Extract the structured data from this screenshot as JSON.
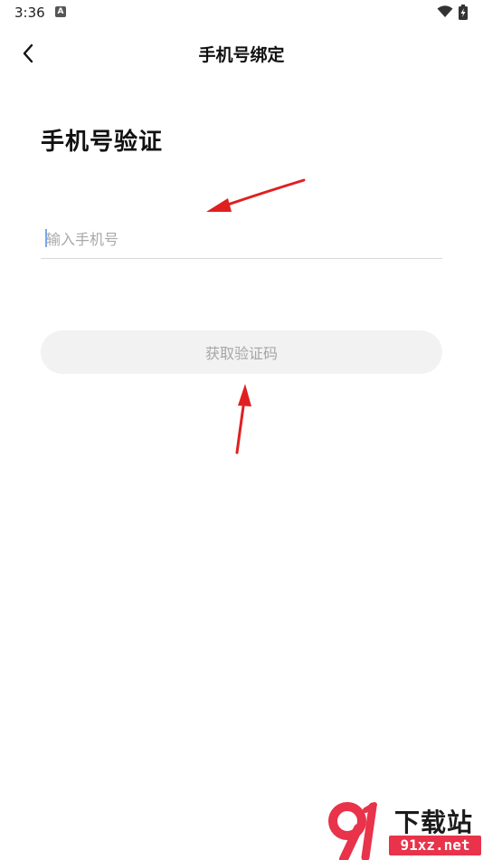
{
  "status_bar": {
    "time": "3:36",
    "notification_icon": "a-icon",
    "wifi_icon": "wifi-icon",
    "battery_icon": "battery-charging-icon"
  },
  "nav": {
    "back_icon": "chevron-left-icon",
    "title": "手机号绑定"
  },
  "page": {
    "heading": "手机号验证"
  },
  "phone_input": {
    "placeholder": "输入手机号",
    "value": ""
  },
  "get_code_button": {
    "label": "获取验证码"
  },
  "annotations": {
    "arrow_color": "#e02020"
  },
  "watermark": {
    "logo_icon": "91-logo-icon",
    "title": "下载站",
    "domain": "91xz.net",
    "brand_color": "#e8334a"
  }
}
